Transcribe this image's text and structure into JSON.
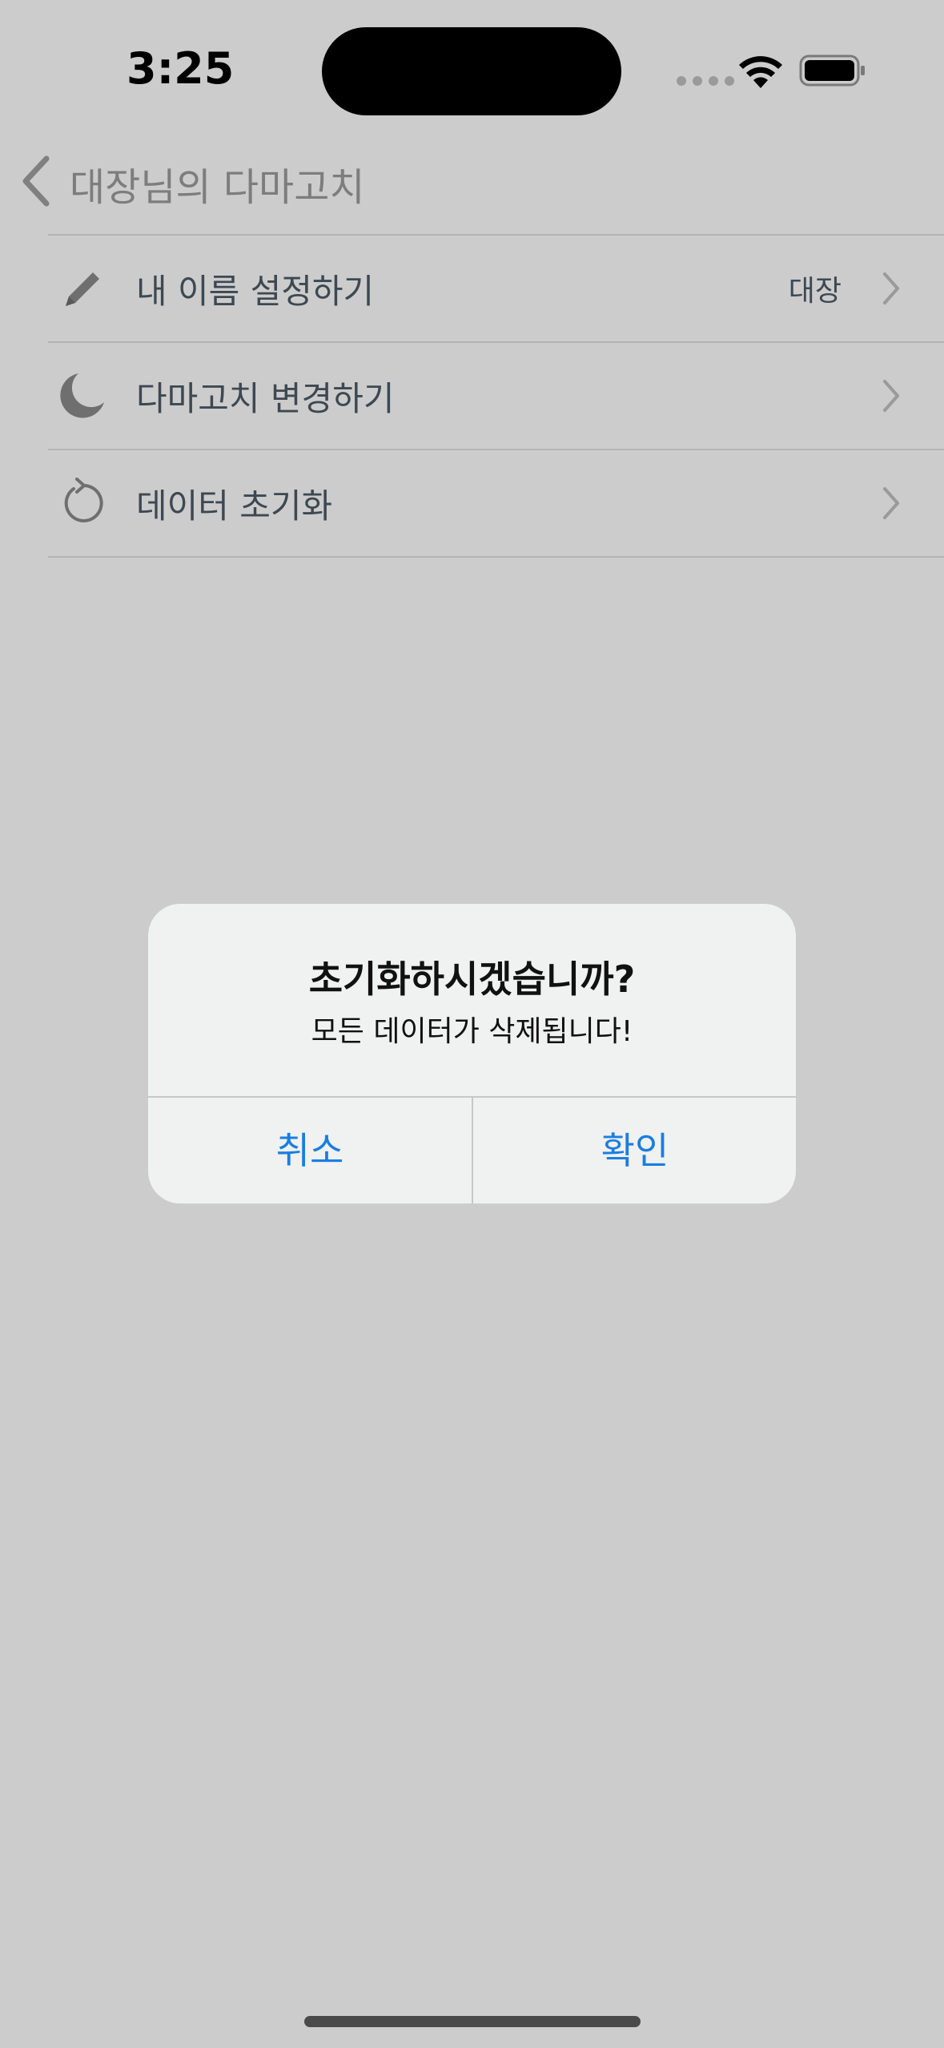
{
  "status_bar": {
    "time": "3:25",
    "icons": [
      "cellular-signal-icon",
      "wifi-icon",
      "battery-icon"
    ]
  },
  "nav": {
    "back_icon": "chevron-left-icon",
    "title": "대장님의 다마고치"
  },
  "settings_list": [
    {
      "icon": "pencil-icon",
      "label": "내 이름 설정하기",
      "value": "대장"
    },
    {
      "icon": "moon-icon",
      "label": "다마고치 변경하기",
      "value": ""
    },
    {
      "icon": "refresh-icon",
      "label": "데이터 초기화",
      "value": ""
    }
  ],
  "alert": {
    "title": "초기화하시겠습니까?",
    "message": "모든 데이터가 삭제됩니다!",
    "cancel_label": "취소",
    "confirm_label": "확인"
  },
  "colors": {
    "dimmed_background": "#cccccc",
    "alert_background": "#f0f1f1",
    "action_blue": "#1a7ee0",
    "row_text": "#3d4852"
  }
}
